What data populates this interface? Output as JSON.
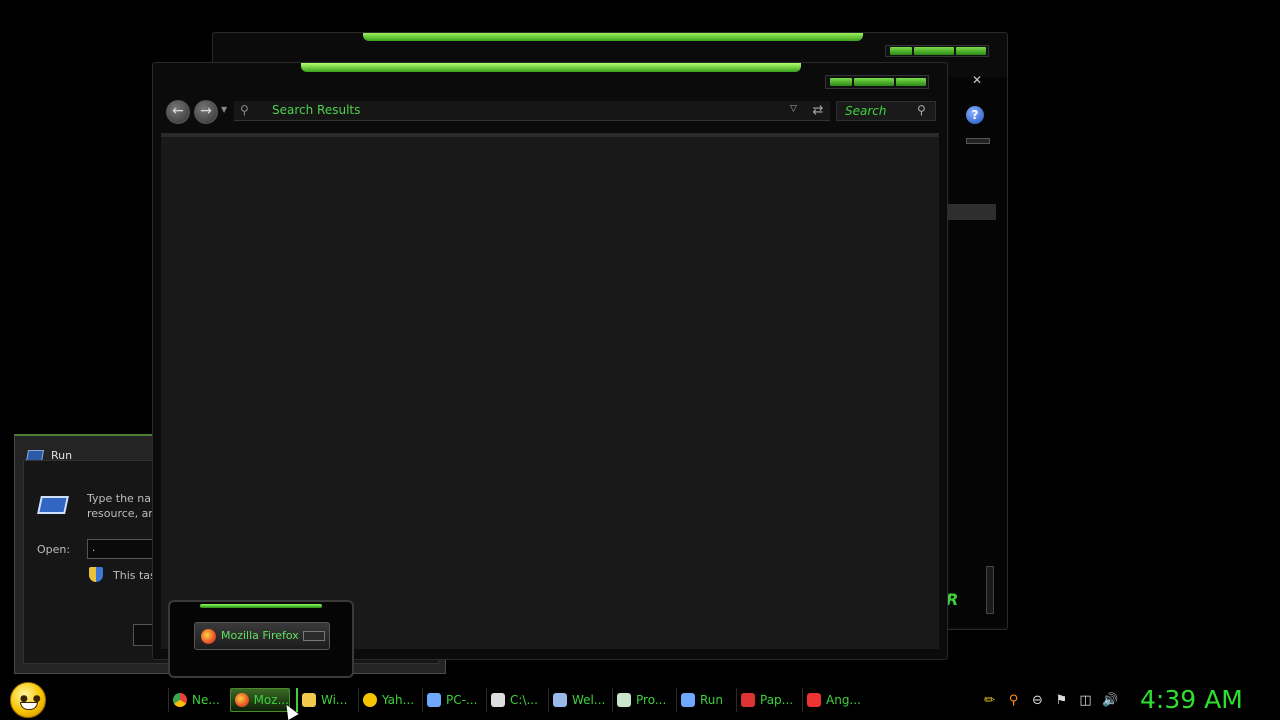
{
  "colors": {
    "accent_green": "#3ed13e",
    "background": "#000000",
    "pane": "#191919"
  },
  "explorer": {
    "address": "Search Results",
    "search_placeholder": "Search",
    "icons": {
      "back": "back-arrow-icon",
      "forward": "forward-arrow-icon",
      "refresh": "refresh-icon",
      "search": "search-icon"
    }
  },
  "back_window": {
    "close_glyph": "✕",
    "help_glyph": "?",
    "logo_text": "R"
  },
  "run_dialog": {
    "title": "Run",
    "description_line1": "Type the nar",
    "description_line2": "resource, an",
    "open_label": "Open:",
    "open_value": ".",
    "admin_note": "This tas"
  },
  "thumbnail": {
    "label": "Mozilla Firefox"
  },
  "taskbar": {
    "buttons": [
      {
        "label": "Ne...",
        "icon": "chrome-icon",
        "color": "#4285f4"
      },
      {
        "label": "Moz...",
        "icon": "firefox-icon",
        "color": "#e9552a",
        "active": true
      },
      {
        "label": "Wi...",
        "icon": "folder-icon",
        "color": "#f2c94c"
      },
      {
        "label": "Yah...",
        "icon": "yahoo-messenger-icon",
        "color": "#f7c400"
      },
      {
        "label": "PC-...",
        "icon": "computer-icon",
        "color": "#6fa8ff"
      },
      {
        "label": "C:\\...",
        "icon": "console-icon",
        "color": "#dddddd"
      },
      {
        "label": "Wel...",
        "icon": "document-icon",
        "color": "#9ab8e8"
      },
      {
        "label": "Pro...",
        "icon": "properties-icon",
        "color": "#c8e6c9"
      },
      {
        "label": "Run",
        "icon": "run-icon",
        "color": "#6fa8ff"
      },
      {
        "label": "Pap...",
        "icon": "paper-icon",
        "color": "#d33"
      },
      {
        "label": "Ang...",
        "icon": "angry-birds-icon",
        "color": "#e33"
      }
    ],
    "tray_icons": [
      "pen-icon",
      "search-orange-icon",
      "minus-circle-icon",
      "flag-icon",
      "network-icon",
      "volume-icon"
    ],
    "clock": "4:39 AM"
  }
}
